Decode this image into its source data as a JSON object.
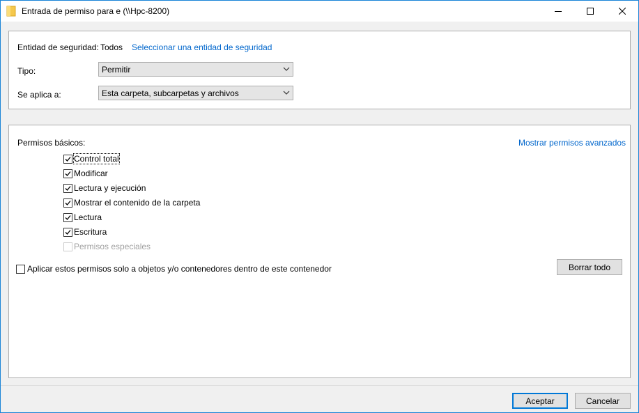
{
  "window": {
    "title": "Entrada de permiso para e (\\\\Hpc-8200)"
  },
  "principal": {
    "label": "Entidad de seguridad:",
    "value": "Todos",
    "select_link": "Seleccionar una entidad de seguridad"
  },
  "type": {
    "label": "Tipo:",
    "value": "Permitir"
  },
  "applies": {
    "label": "Se aplica a:",
    "value": "Esta carpeta, subcarpetas y archivos"
  },
  "permissions": {
    "heading": "Permisos básicos:",
    "advanced_link": "Mostrar permisos avanzados",
    "items": [
      {
        "label": "Control total",
        "checked": true,
        "enabled": true
      },
      {
        "label": "Modificar",
        "checked": true,
        "enabled": true
      },
      {
        "label": "Lectura y ejecución",
        "checked": true,
        "enabled": true
      },
      {
        "label": "Mostrar el contenido de la carpeta",
        "checked": true,
        "enabled": true
      },
      {
        "label": "Lectura",
        "checked": true,
        "enabled": true
      },
      {
        "label": "Escritura",
        "checked": true,
        "enabled": true
      },
      {
        "label": "Permisos especiales",
        "checked": false,
        "enabled": false
      }
    ],
    "apply_only": {
      "label": "Aplicar estos permisos solo a objetos y/o contenedores dentro de este contenedor",
      "checked": false
    },
    "clear_all": "Borrar todo"
  },
  "footer": {
    "ok": "Aceptar",
    "cancel": "Cancelar"
  },
  "colors": {
    "accent": "#0078d7",
    "link": "#0066cc",
    "folder": "#f5c84c"
  }
}
